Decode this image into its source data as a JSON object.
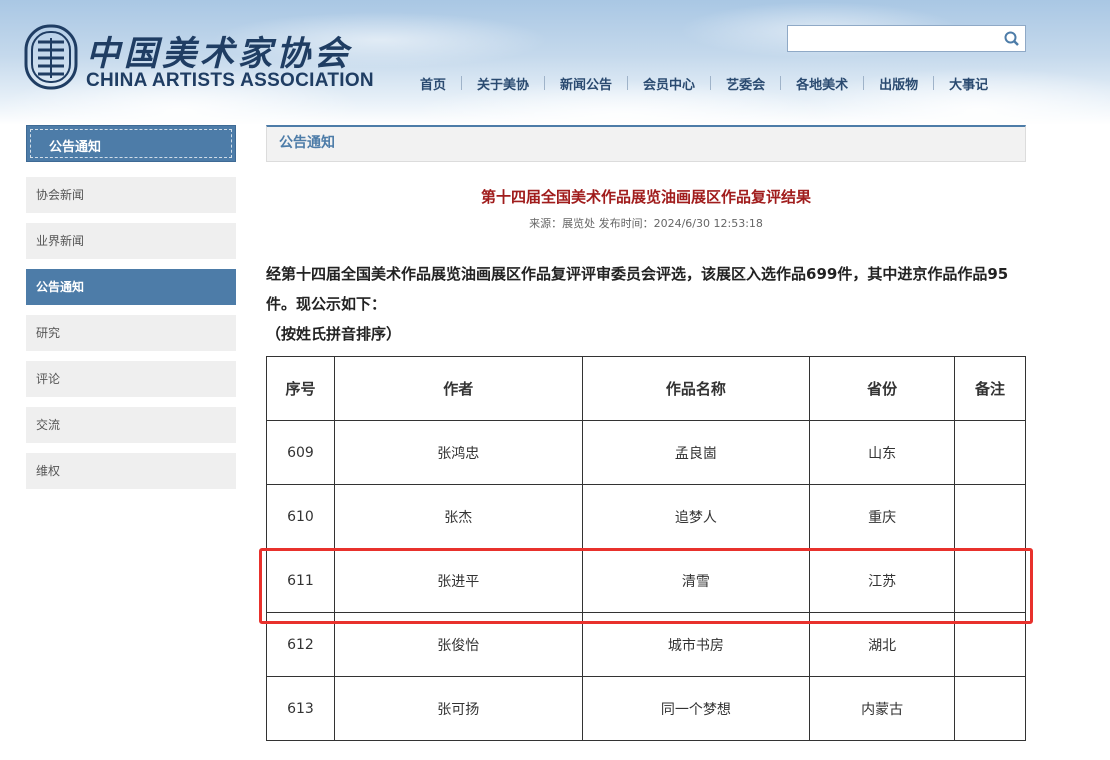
{
  "header": {
    "logo_cn": "中国美术家协会",
    "logo_en": "CHINA ARTISTS ASSOCIATION",
    "search": {
      "value": "",
      "placeholder": ""
    },
    "nav": [
      "首页",
      "关于美协",
      "新闻公告",
      "会员中心",
      "艺委会",
      "各地美术",
      "出版物",
      "大事记"
    ]
  },
  "sidebar": {
    "title": "公告通知",
    "items": [
      {
        "label": "协会新闻",
        "active": false
      },
      {
        "label": "业界新闻",
        "active": false
      },
      {
        "label": "公告通知",
        "active": true
      },
      {
        "label": "研究",
        "active": false
      },
      {
        "label": "评论",
        "active": false
      },
      {
        "label": "交流",
        "active": false
      },
      {
        "label": "维权",
        "active": false
      }
    ]
  },
  "main": {
    "section_title": "公告通知",
    "article": {
      "title": "第十四届全国美术作品展览油画展区作品复评结果",
      "meta": "来源：展览处 发布时间：2024/6/30 12:53:18",
      "body": "经第十四届全国美术作品展览油画展区作品复评评审委员会评选，该展区入选作品699件，其中进京作品作品95件。现公示如下：",
      "note": "（按姓氏拼音排序）"
    },
    "table": {
      "headers": [
        "序号",
        "作者",
        "作品名称",
        "省份",
        "备注"
      ],
      "rows": [
        [
          "609",
          "张鸿忠",
          "孟良崮",
          "山东",
          ""
        ],
        [
          "610",
          "张杰",
          "追梦人",
          "重庆",
          ""
        ],
        [
          "611",
          "张进平",
          "清雪",
          "江苏",
          ""
        ],
        [
          "612",
          "张俊怡",
          "城市书房",
          "湖北",
          ""
        ],
        [
          "613",
          "张可扬",
          "同一个梦想",
          "内蒙古",
          ""
        ]
      ],
      "highlighted_row": "611"
    }
  },
  "colors": {
    "accent": "#4d7ca8",
    "title_red": "#a01c1c",
    "highlight_red": "#e8312c"
  }
}
